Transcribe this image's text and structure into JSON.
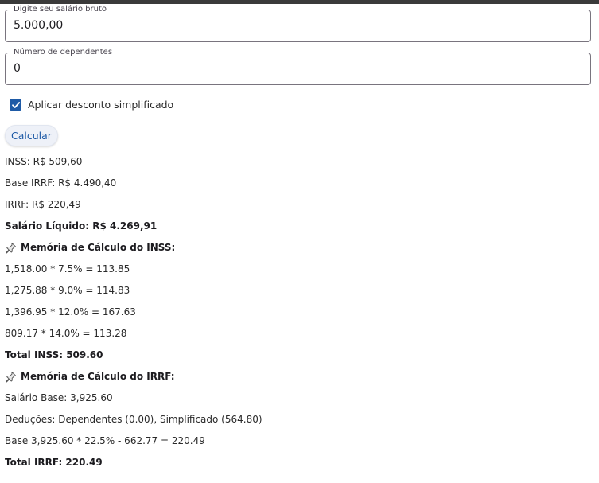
{
  "form": {
    "salary": {
      "label": "Digite seu salário bruto",
      "value": "5.000,00"
    },
    "dependents": {
      "label": "Número de dependentes",
      "value": "0"
    },
    "simplified": {
      "label": "Aplicar desconto simplificado",
      "checked": true
    },
    "calculate_label": "Calcular"
  },
  "results": {
    "inss": "INSS: R$ 509,60",
    "base_irrf": "Base IRRF: R$ 4.490,40",
    "irrf": "IRRF: R$ 220,49",
    "net_salary": "Salário Líquido: R$ 4.269,91"
  },
  "inss_memory": {
    "title": "Memória de Cálculo do INSS:",
    "icon": "pushpin-icon",
    "lines": [
      "1,518.00 * 7.5% = 113.85",
      "1,275.88 * 9.0% = 114.83",
      "1,396.95 * 12.0% = 167.63",
      "809.17 * 14.0% = 113.28"
    ],
    "total": "Total INSS: 509.60"
  },
  "irrf_memory": {
    "title": "Memória de Cálculo do IRRF:",
    "icon": "pushpin-icon",
    "lines": [
      "Salário Base: 3,925.60",
      "Deduções: Dependentes (0.00), Simplificado (564.80)",
      "Base 3,925.60 * 22.5% - 662.77 = 220.49"
    ],
    "total": "Total IRRF: 220.49"
  },
  "colors": {
    "accent": "#1e5aa6",
    "border": "#79747e"
  }
}
